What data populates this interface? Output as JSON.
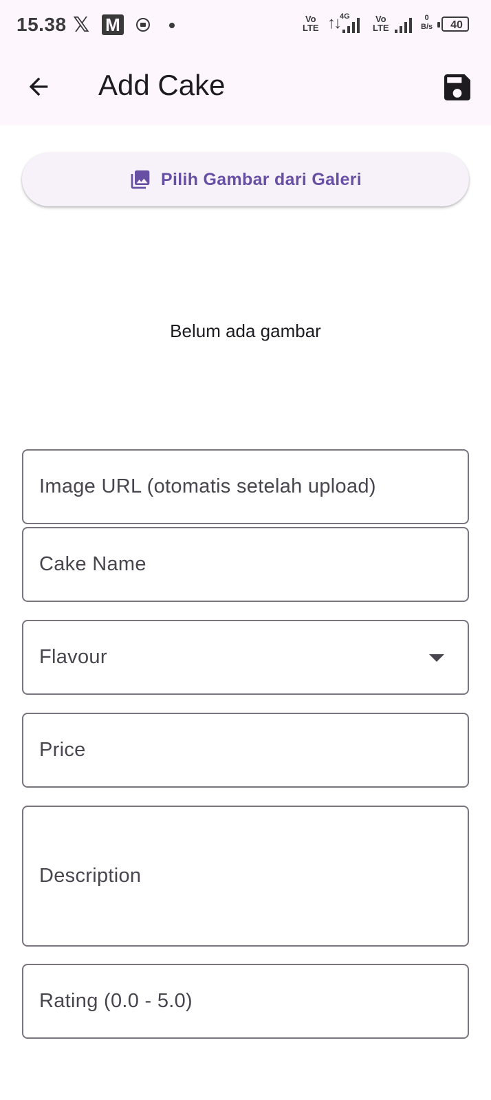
{
  "status_bar": {
    "time": "15.38",
    "x_glyph": "𝕏",
    "m_glyph": "M",
    "network_1_top": "Vo",
    "network_1_bottom": "LTE",
    "network_type": "4G",
    "network_2_top": "Vo",
    "network_2_bottom": "LTE",
    "speed_value": "0",
    "speed_unit": "B/s",
    "battery": "40",
    "icons": [
      "x-app-icon",
      "m-app-icon",
      "screen-record-icon",
      "notification-dot-icon",
      "data-transfer-icon",
      "signal-icon",
      "signal-icon",
      "battery-icon"
    ]
  },
  "app_bar": {
    "title": "Add Cake",
    "back_icon": "arrow-back-icon",
    "save_icon": "save-icon"
  },
  "gallery_button": {
    "label": "Pilih Gambar dari Galeri",
    "icon": "photo-library-icon"
  },
  "image_preview": {
    "empty_text": "Belum ada gambar"
  },
  "form": {
    "image_url": {
      "placeholder": "Image URL (otomatis setelah upload)",
      "value": ""
    },
    "cake_name": {
      "placeholder": "Cake Name",
      "value": ""
    },
    "flavour": {
      "placeholder": "Flavour",
      "selected": "",
      "icon": "dropdown-arrow-icon"
    },
    "price": {
      "placeholder": "Price",
      "value": ""
    },
    "description": {
      "placeholder": "Description",
      "value": ""
    },
    "rating": {
      "placeholder": "Rating (0.0 - 5.0)",
      "value": ""
    }
  },
  "colors": {
    "accent": "#6750a4",
    "top_background": "#fdf7fd",
    "outline": "#79747e",
    "text": "#1d1b20"
  }
}
